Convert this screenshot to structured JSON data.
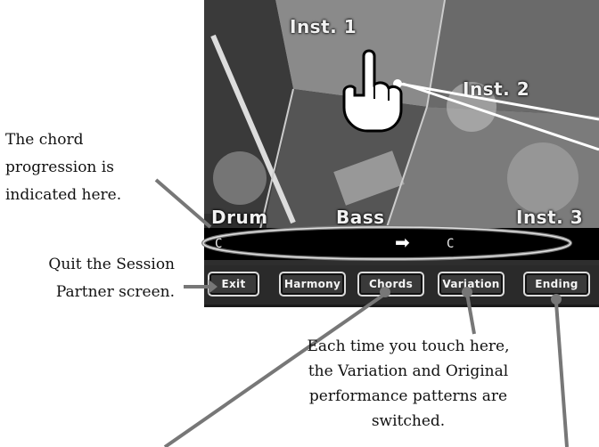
{
  "screen": {
    "panels": {
      "inst1": "Inst. 1",
      "inst2": "Inst. 2",
      "inst3": "Inst. 3",
      "drum": "Drum",
      "bass": "Bass"
    },
    "chord_bar": {
      "left_chord": "C",
      "arrow": "➡",
      "right_chord": "C"
    },
    "buttons": {
      "exit": "Exit",
      "harmony": "Harmony",
      "chords": "Chords",
      "variation": "Variation",
      "ending": "Ending"
    }
  },
  "annotations": {
    "chord_progression": "The chord progression is indicated here.",
    "quit": "Quit the Session Partner screen.",
    "variation": "Each time you touch here, the Variation and Original performance patterns are switched."
  },
  "colors": {
    "screen_bg": "#1a1a1a",
    "leader_line": "#777777",
    "chord_ring": "#e0e0e0"
  },
  "icons": {
    "touch": "pointing-hand-icon",
    "arrow": "right-arrow-icon"
  }
}
